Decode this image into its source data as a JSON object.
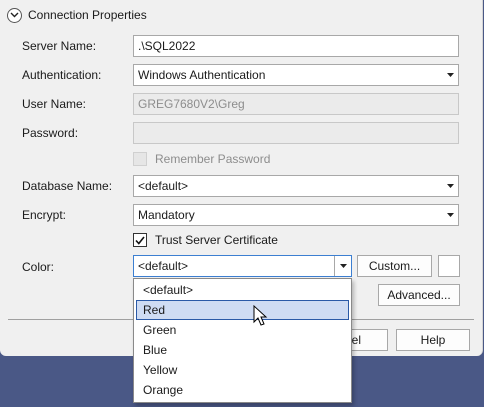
{
  "section": {
    "title": "Connection Properties"
  },
  "form": {
    "server_name": {
      "label": "Server Name:",
      "value": ".\\SQL2022"
    },
    "authentication": {
      "label": "Authentication:",
      "value": "Windows Authentication"
    },
    "user_name": {
      "label": "User Name:",
      "value": "GREG7680V2\\Greg"
    },
    "password": {
      "label": "Password:",
      "value": ""
    },
    "remember_password": {
      "label": "Remember Password",
      "checked": false,
      "enabled": false
    },
    "database_name": {
      "label": "Database Name:",
      "value": "<default>"
    },
    "encrypt": {
      "label": "Encrypt:",
      "value": "Mandatory"
    },
    "trust_cert": {
      "label": "Trust Server Certificate",
      "checked": true
    },
    "color": {
      "label": "Color:",
      "value": "<default>"
    }
  },
  "buttons": {
    "custom": "Custom...",
    "advanced": "Advanced...",
    "cancel_partial": "cel",
    "help": "Help"
  },
  "color_dropdown": {
    "options": [
      "<default>",
      "Red",
      "Green",
      "Blue",
      "Yellow",
      "Orange"
    ],
    "hovered": "Red"
  },
  "colors": {
    "window_bg": "#f0f0f0",
    "backdrop": "#4a5886",
    "hover_bg": "#cfdcf3",
    "hover_border": "#2b5aa7"
  }
}
